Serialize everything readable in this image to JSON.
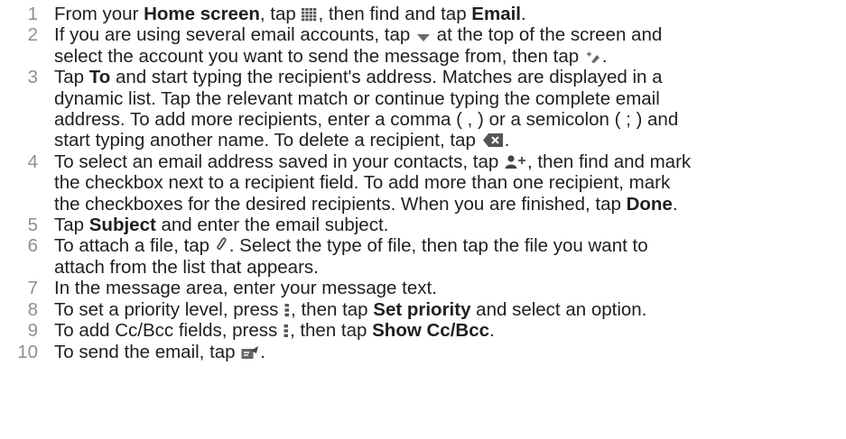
{
  "steps": [
    {
      "number": "1",
      "lines": [
        [
          {
            "t": "From your "
          },
          {
            "b": "Home screen"
          },
          {
            "t": ", tap "
          },
          {
            "icon": "apps-grid-icon"
          },
          {
            "t": ", then find and tap "
          },
          {
            "b": "Email"
          },
          {
            "t": "."
          }
        ]
      ]
    },
    {
      "number": "2",
      "lines": [
        [
          {
            "t": "If you are using several email accounts, tap "
          },
          {
            "icon": "dropdown-triangle-icon"
          },
          {
            "t": " at the top of the screen and"
          }
        ],
        [
          {
            "t": "select the account you want to send the message from, then tap "
          },
          {
            "icon": "compose-icon"
          },
          {
            "t": "."
          }
        ]
      ]
    },
    {
      "number": "3",
      "lines": [
        [
          {
            "t": "Tap "
          },
          {
            "b": "To"
          },
          {
            "t": " and start typing the recipient's address. Matches are displayed in a"
          }
        ],
        [
          {
            "t": "dynamic list. Tap the relevant match or continue typing the complete email"
          }
        ],
        [
          {
            "t": "address. To add more recipients, enter a comma ( , ) or a semicolon ( ; ) and"
          }
        ],
        [
          {
            "t": "start typing another name. To delete a recipient, tap "
          },
          {
            "icon": "delete-recipient-icon"
          },
          {
            "t": "."
          }
        ]
      ]
    },
    {
      "number": "4",
      "lines": [
        [
          {
            "t": "To select an email address saved in your contacts, tap "
          },
          {
            "icon": "add-contact-icon"
          },
          {
            "t": ", then find and mark"
          }
        ],
        [
          {
            "t": "the checkbox next to a recipient field. To add more than one recipient, mark"
          }
        ],
        [
          {
            "t": "the checkboxes for the desired recipients. When you are finished, tap "
          },
          {
            "b": "Done"
          },
          {
            "t": "."
          }
        ]
      ]
    },
    {
      "number": "5",
      "lines": [
        [
          {
            "t": "Tap "
          },
          {
            "b": "Subject"
          },
          {
            "t": " and enter the email subject."
          }
        ]
      ]
    },
    {
      "number": "6",
      "lines": [
        [
          {
            "t": "To attach a file, tap "
          },
          {
            "icon": "attachment-icon"
          },
          {
            "t": ". Select the type of file, then tap the file you want to"
          }
        ],
        [
          {
            "t": "attach from the list that appears."
          }
        ]
      ]
    },
    {
      "number": "7",
      "lines": [
        [
          {
            "t": "In the message area, enter your message text."
          }
        ]
      ]
    },
    {
      "number": "8",
      "lines": [
        [
          {
            "t": "To set a priority level, press "
          },
          {
            "icon": "menu-icon"
          },
          {
            "t": ", then tap "
          },
          {
            "b": "Set priority"
          },
          {
            "t": " and select an option."
          }
        ]
      ]
    },
    {
      "number": "9",
      "lines": [
        [
          {
            "t": "To add Cc/Bcc fields, press "
          },
          {
            "icon": "menu-icon"
          },
          {
            "t": ", then tap "
          },
          {
            "b": "Show Cc/Bcc"
          },
          {
            "t": "."
          }
        ]
      ]
    },
    {
      "number": "10",
      "lines": [
        [
          {
            "t": "To send the email, tap "
          },
          {
            "icon": "send-icon"
          },
          {
            "t": "."
          }
        ]
      ]
    }
  ]
}
